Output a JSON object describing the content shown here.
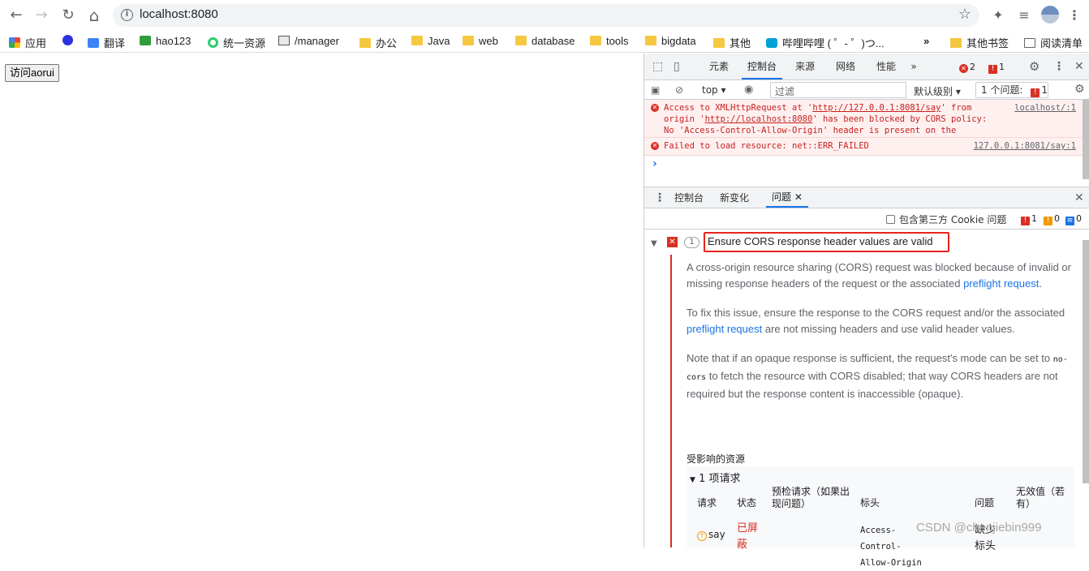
{
  "toolbar": {
    "back": "←",
    "forward": "→",
    "reload": "↻",
    "home": "⌂",
    "url": "localhost:8080",
    "info_glyph": "i",
    "star": "☆"
  },
  "bookmarks": [
    {
      "label": "应用",
      "icon": "apps-grid-icon"
    },
    {
      "label": "",
      "icon": "baidu-paw-icon"
    },
    {
      "label": "翻译",
      "icon": "translate-icon"
    },
    {
      "label": "hao123",
      "icon": "hao123-icon"
    },
    {
      "label": "统一资源",
      "icon": "green-ring-icon"
    },
    {
      "label": "/manager",
      "icon": "image-icon"
    },
    {
      "label": "办公",
      "icon": "folder-icon"
    },
    {
      "label": "Java",
      "icon": "folder-icon"
    },
    {
      "label": "web",
      "icon": "folder-icon"
    },
    {
      "label": "database",
      "icon": "folder-icon"
    },
    {
      "label": "tools",
      "icon": "folder-icon"
    },
    {
      "label": "bigdata",
      "icon": "folder-icon"
    },
    {
      "label": "其他",
      "icon": "folder-icon"
    },
    {
      "label": "哔哩哔哩 ( ゜- ゜)つ...",
      "icon": "bilibili-icon"
    },
    {
      "label": "其他书签",
      "icon": "folder-icon"
    },
    {
      "label": "阅读清单",
      "icon": "reading-list-icon"
    }
  ],
  "bookmarks_more": "»",
  "page": {
    "button_label": "访问aorui"
  },
  "devtools": {
    "tabs": [
      "元素",
      "控制台",
      "来源",
      "网络",
      "性能"
    ],
    "more": "»",
    "error_count": "2",
    "issue_count": "1",
    "context": "top",
    "filter_placeholder": "过滤",
    "level": "默认级别",
    "issues_pill": "1 个问题:",
    "issues_pill_count": "1",
    "console_messages": [
      {
        "parts": [
          "Access to XMLHttpRequest at '",
          "http://127.0.0.1:8081/say",
          "' from origin '",
          "http://localhost:8080",
          "' has been blocked by CORS policy: No 'Access-Control-Allow-Origin' header is present on the requested resource."
        ],
        "source": "localhost/:1"
      },
      {
        "text": "Failed to load resource: net::ERR_FAILED",
        "source": "127.0.0.1:8081/say:1"
      }
    ],
    "prompt": "›",
    "drawer_tabs": [
      "控制台",
      "新变化",
      "问题"
    ],
    "third_party": "包含第三方 Cookie 问题",
    "counts": {
      "error": "1",
      "warning": "0",
      "info": "0"
    },
    "issue": {
      "occurrences": "1",
      "title": "Ensure CORS response header values are valid",
      "p1_before": "A cross-origin resource sharing (CORS) request was blocked because of invalid or missing response headers of the request or the associated ",
      "p1_link": "preflight request",
      "p1_after": ".",
      "p2_before": "To fix this issue, ensure the response to the CORS request and/or the associated ",
      "p2_link": "preflight request",
      "p2_after": " are not missing headers and use valid header values.",
      "p3_before": "Note that if an opaque response is sufficient, the request's mode can be set to ",
      "p3_code": "no-cors",
      "p3_after": " to fetch the resource with CORS disabled; that way CORS headers are not required but the response content is inaccessible (opaque).",
      "affected": "受影响的资源",
      "requests_label": "1 项请求",
      "table_headers": [
        "请求",
        "状态",
        "预检请求（如果出现问题）",
        "标头",
        "问题",
        "无效值（若有）"
      ],
      "row": {
        "request": "say",
        "status": "已屏蔽",
        "header": "Access-Control-Allow-Origin",
        "problem": "缺少标头"
      }
    }
  },
  "watermark": "CSDN @chenjiebin999",
  "colors": {
    "error": "#d93025",
    "link": "#1a73e8",
    "highlight_box": "#e8241c",
    "console_error_bg": "#fff0f0"
  }
}
